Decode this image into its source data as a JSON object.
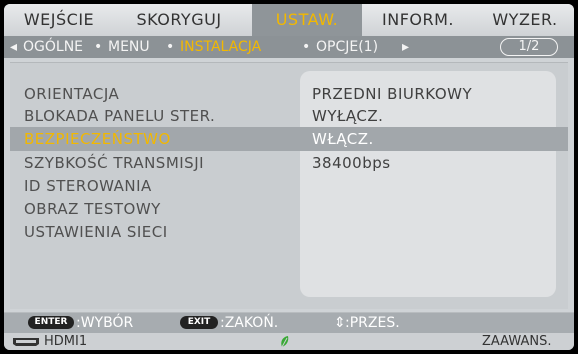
{
  "tabs": [
    {
      "label": "WEJŚCIE",
      "active": false
    },
    {
      "label": "SKORYGUJ",
      "active": false
    },
    {
      "label": "USTAW.",
      "active": true
    },
    {
      "label": "INFORM.",
      "active": false
    },
    {
      "label": "WYZER.",
      "active": false
    }
  ],
  "subtabs": {
    "items": [
      "OGÓLNE",
      "MENU",
      "INSTALACJA",
      "OPCJE(1)"
    ],
    "active": "INSTALACJA",
    "page": "1/2"
  },
  "menu": {
    "items": [
      {
        "label": "ORIENTACJA",
        "value": "PRZEDNI BIURKOWY"
      },
      {
        "label": "BLOKADA PANELU STER.",
        "value": "WYŁĄCZ."
      },
      {
        "label": "BEZPIECZEŃSTWO",
        "value": "WŁĄCZ.",
        "selected": true
      },
      {
        "label": "SZYBKOŚĆ TRANSMISJI",
        "value": "38400bps"
      },
      {
        "label": "ID STEROWANIA",
        "value": ""
      },
      {
        "label": "OBRAZ TESTOWY",
        "value": ""
      },
      {
        "label": "USTAWIENIA SIECI",
        "value": ""
      }
    ]
  },
  "footer": {
    "enter_key": "ENTER",
    "enter_label": ":WYBÓR",
    "exit_key": "EXIT",
    "exit_label": ":ZAKOŃ.",
    "move_label": ":PRZES.",
    "source": "HDMI1",
    "mode": "ZAAWANS."
  },
  "colors": {
    "highlight": "#f2b800",
    "background": "#cfd3d6"
  }
}
